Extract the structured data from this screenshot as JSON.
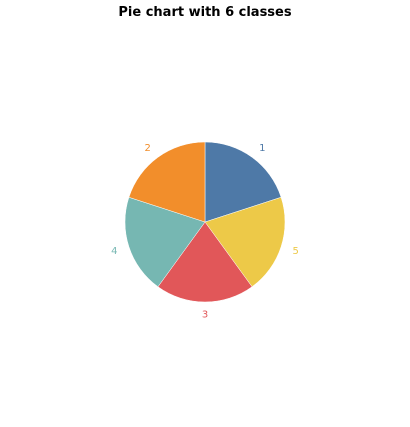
{
  "chart_data": {
    "type": "pie",
    "title": "Pie chart with 6 classes",
    "start_angle_deg": 0,
    "direction": "clockwise",
    "slices": [
      {
        "label": "1",
        "value": 1,
        "color": "#4e79a7"
      },
      {
        "label": "5",
        "value": 1,
        "color": "#edc948"
      },
      {
        "label": "3",
        "value": 1,
        "color": "#e15759"
      },
      {
        "label": "4",
        "value": 1,
        "color": "#76b7b2"
      },
      {
        "label": "2",
        "value": 1,
        "color": "#f28e2b"
      }
    ]
  }
}
